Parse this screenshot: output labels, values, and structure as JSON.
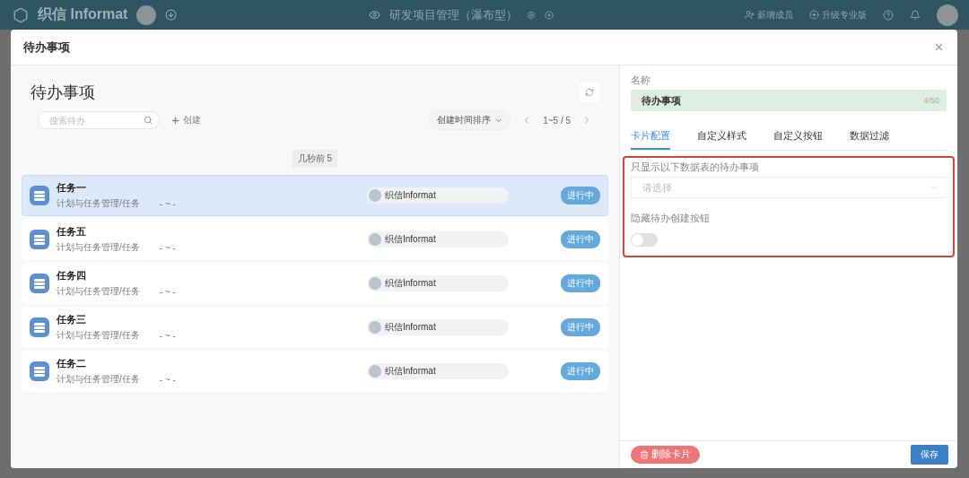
{
  "topbar": {
    "logo": "织信 Informat",
    "project": "研发项目管理（瀑布型）",
    "actions": [
      {
        "kind": "member",
        "label": "新增成员"
      },
      {
        "kind": "upgrade",
        "label": "升级专业版"
      }
    ]
  },
  "dialog": {
    "title": "待办事项",
    "list": {
      "title": "待办事项",
      "search": {
        "placeholder": "搜索待办"
      },
      "create": "创建",
      "sort": "创建时间排序",
      "pager": "1~5 / 5",
      "group": "几秒前 5",
      "items": [
        {
          "title": "任务一",
          "path": "计划与任务管理/任务",
          "date": "- ~ -",
          "owner": "织信Informat",
          "status": "进行中",
          "selected": true
        },
        {
          "title": "任务五",
          "path": "计划与任务管理/任务",
          "date": "- ~ -",
          "owner": "织信Informat",
          "status": "进行中",
          "selected": false
        },
        {
          "title": "任务四",
          "path": "计划与任务管理/任务",
          "date": "- ~ -",
          "owner": "织信Informat",
          "status": "进行中",
          "selected": false
        },
        {
          "title": "任务三",
          "path": "计划与任务管理/任务",
          "date": "- ~ -",
          "owner": "织信Informat",
          "status": "进行中",
          "selected": false
        },
        {
          "title": "任务二",
          "path": "计划与任务管理/任务",
          "date": "- ~ -",
          "owner": "织信Informat",
          "status": "进行中",
          "selected": false
        }
      ]
    },
    "settings": {
      "name_label": "名称",
      "name_value": "待办事项",
      "name_count": "4/50",
      "tabs": [
        {
          "label": "卡片配置",
          "selected": true
        },
        {
          "label": "自定义样式",
          "selected": false
        },
        {
          "label": "自定义按钮",
          "selected": false
        },
        {
          "label": "数据过滤",
          "selected": false
        }
      ],
      "filter_label": "只显示以下数据表的待办事项",
      "filter": {
        "placeholder": "请选择"
      },
      "hide_label": "隐藏待办创建按钮",
      "hide_create": {
        "on": false
      },
      "delete": "删除卡片",
      "save": "保存"
    }
  }
}
